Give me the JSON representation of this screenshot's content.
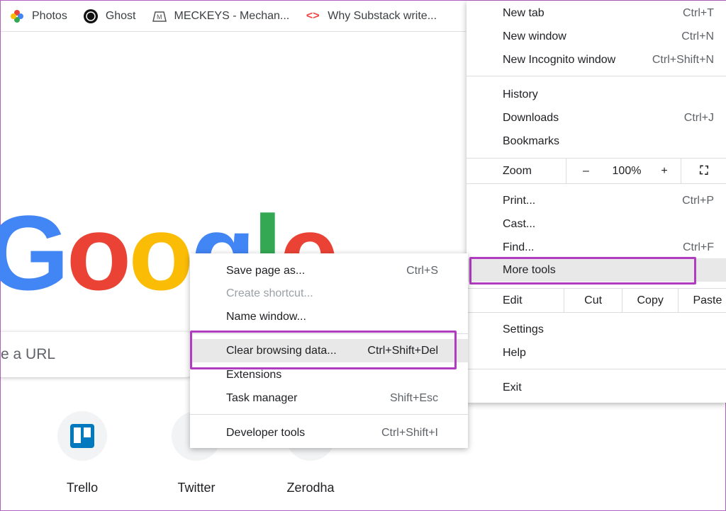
{
  "bookmarks": [
    {
      "label": "Photos",
      "icon": "google-photos-icon"
    },
    {
      "label": "Ghost",
      "icon": "ghost-icon"
    },
    {
      "label": "MECKEYS - Mechan...",
      "icon": "meckeys-icon"
    },
    {
      "label": "Why Substack write...",
      "icon": "code-icon"
    }
  ],
  "logo_text": "Google",
  "search": {
    "placeholder": "e a URL"
  },
  "shortcuts": [
    {
      "label": "Trello"
    },
    {
      "label": "Twitter"
    },
    {
      "label": "Zerodha"
    }
  ],
  "menu": {
    "new_tab": {
      "label": "New tab",
      "key": "Ctrl+T"
    },
    "new_window": {
      "label": "New window",
      "key": "Ctrl+N"
    },
    "incognito": {
      "label": "New Incognito window",
      "key": "Ctrl+Shift+N"
    },
    "history": {
      "label": "History"
    },
    "downloads": {
      "label": "Downloads",
      "key": "Ctrl+J"
    },
    "bookmarks": {
      "label": "Bookmarks"
    },
    "zoom": {
      "label": "Zoom",
      "minus": "–",
      "value": "100%",
      "plus": "+"
    },
    "print": {
      "label": "Print...",
      "key": "Ctrl+P"
    },
    "cast": {
      "label": "Cast..."
    },
    "find": {
      "label": "Find...",
      "key": "Ctrl+F"
    },
    "more_tools": {
      "label": "More tools"
    },
    "edit": {
      "label": "Edit",
      "cut": "Cut",
      "copy": "Copy",
      "paste": "Paste"
    },
    "settings": {
      "label": "Settings"
    },
    "help": {
      "label": "Help"
    },
    "exit": {
      "label": "Exit"
    }
  },
  "submenu": {
    "save": {
      "label": "Save page as...",
      "key": "Ctrl+S"
    },
    "shortcut": {
      "label": "Create shortcut..."
    },
    "name_window": {
      "label": "Name window..."
    },
    "clear": {
      "label": "Clear browsing data...",
      "key": "Ctrl+Shift+Del"
    },
    "extensions": {
      "label": "Extensions"
    },
    "task": {
      "label": "Task manager",
      "key": "Shift+Esc"
    },
    "dev": {
      "label": "Developer tools",
      "key": "Ctrl+Shift+I"
    }
  },
  "highlight_color": "#b03cc0"
}
